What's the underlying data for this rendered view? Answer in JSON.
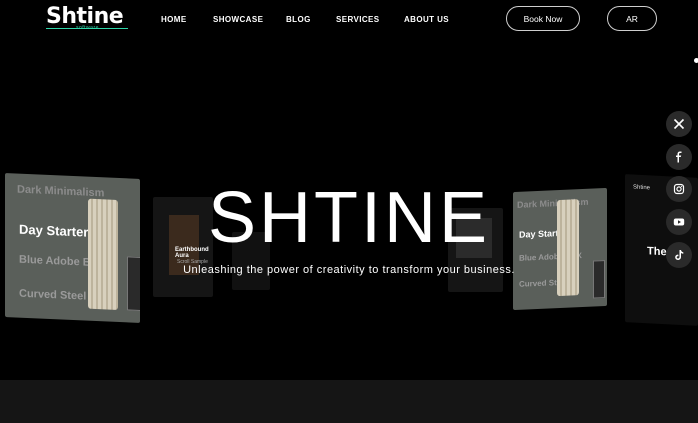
{
  "brand": {
    "name": "Shtine",
    "tagline": "software"
  },
  "nav": {
    "items": [
      {
        "label": "HOME"
      },
      {
        "label": "SHOWCASE"
      },
      {
        "label": "BLOG"
      },
      {
        "label": "SERVICES"
      },
      {
        "label": "ABOUT US"
      }
    ],
    "book_label": "Book Now",
    "lang_label": "AR"
  },
  "hero": {
    "title": "SHTINE",
    "subtitle": "Unleashing the power of creativity to transform your business."
  },
  "showcase": {
    "left_panel": {
      "lines": [
        "Dark Minimalism",
        "Day Starter",
        "Blue Adobe BSX",
        "Curved Steel"
      ]
    },
    "left_small": {
      "lines": [
        "Earthbound Aura",
        "Scroll Sample"
      ]
    },
    "right_panel": {
      "lines": [
        "Dark Minimalism",
        "Day Starter",
        "Blue Adobe BSX",
        "Curved Steel"
      ]
    },
    "far_right": {
      "brand": "Shtine",
      "lines": [
        "The Y..."
      ]
    }
  },
  "social": [
    "x-icon",
    "facebook-icon",
    "instagram-icon",
    "youtube-icon",
    "tiktok-icon"
  ],
  "colors": {
    "background": "#000000",
    "accent": "#2dd4a8",
    "footer": "#151515"
  }
}
